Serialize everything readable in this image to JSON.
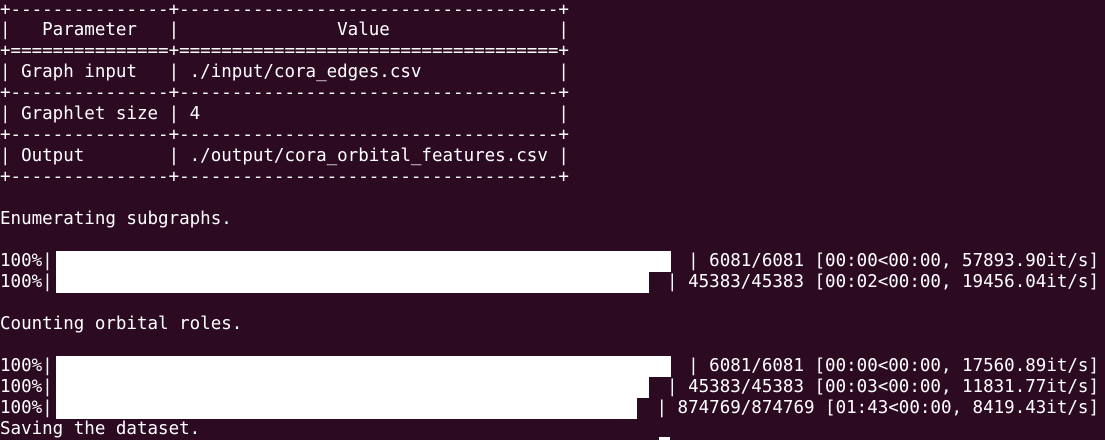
{
  "table": {
    "border_top": "+---------------+------------------------------------+",
    "header_row": "|   Parameter   |               Value                |",
    "header_sep": "+===============+====================================+",
    "row1": "| Graph input   | ./input/cora_edges.csv             |",
    "sep1": "+---------------+------------------------------------+",
    "row2": "| Graphlet size | 4                                  |",
    "sep2": "+---------------+------------------------------------+",
    "row3": "| Output        | ./output/cora_orbital_features.csv |",
    "border_bottom": "+---------------+------------------------------------+"
  },
  "messages": {
    "enumerating": "Enumerating subgraphs.",
    "counting": "Counting orbital roles.",
    "saving": "Saving the dataset."
  },
  "enumerate_bars": [
    {
      "prefix": "100%|",
      "suffix": "| 6081/6081 [00:00<00:00, 57893.90it/s]",
      "progress": 1.0
    },
    {
      "prefix": "100%|",
      "suffix": "| 45383/45383 [00:02<00:00, 19456.04it/s]",
      "progress": 1.0
    }
  ],
  "count_bars": [
    {
      "prefix": "100%|",
      "suffix": "| 6081/6081 [00:00<00:00, 17560.89it/s]",
      "progress": 1.0
    },
    {
      "prefix": "100%|",
      "suffix": "| 45383/45383 [00:03<00:00, 11831.77it/s]",
      "progress": 1.0
    },
    {
      "prefix": "100%|",
      "suffix": "| 874769/874769 [01:43<00:00, 8419.43it/s]",
      "progress": 1.0
    }
  ],
  "colors": {
    "background": "#2c0a22",
    "foreground": "#ffffff"
  }
}
